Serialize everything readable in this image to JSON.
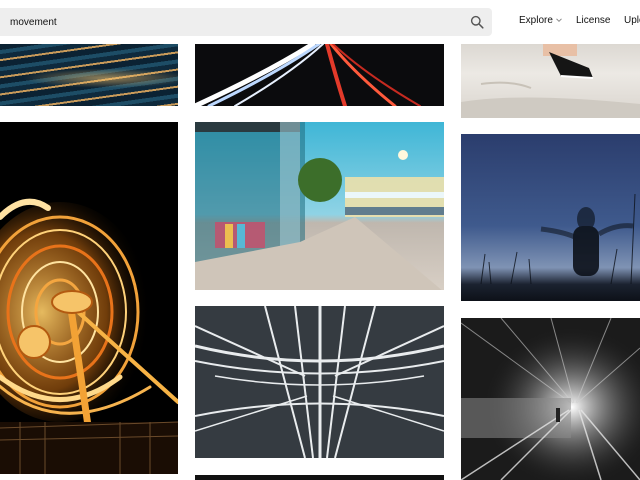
{
  "search": {
    "value": "movement",
    "icon": "search-icon"
  },
  "nav": {
    "explore": "Explore",
    "license": "License",
    "upload": "Uplo"
  },
  "colors": {
    "search_bg": "#eeeeee",
    "page_bg": "#ffffff"
  }
}
